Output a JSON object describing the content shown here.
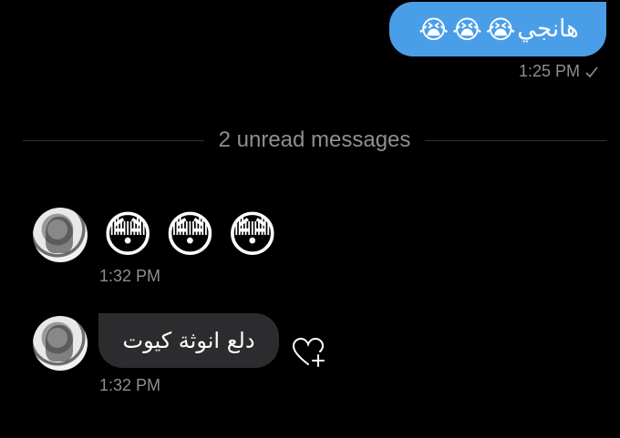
{
  "outgoing": {
    "text": "هانجي",
    "emojis": [
      "😭",
      "😭",
      "😭"
    ],
    "time": "1:25 PM",
    "status_icon": "check-icon"
  },
  "divider": {
    "label": "2 unread messages"
  },
  "incoming": [
    {
      "emojis": [
        "😳",
        "😳",
        "😳"
      ],
      "time": "1:32 PM",
      "avatar_icon": "avatar"
    },
    {
      "text": "دلع انوثة كيوت",
      "time": "1:32 PM",
      "avatar_icon": "avatar",
      "reaction_icon": "heart-plus-icon"
    }
  ],
  "colors": {
    "background": "#000000",
    "outgoing_bubble": "#4a9ee8",
    "incoming_bubble": "#2c2c2e",
    "meta_text": "#8e8e93"
  }
}
